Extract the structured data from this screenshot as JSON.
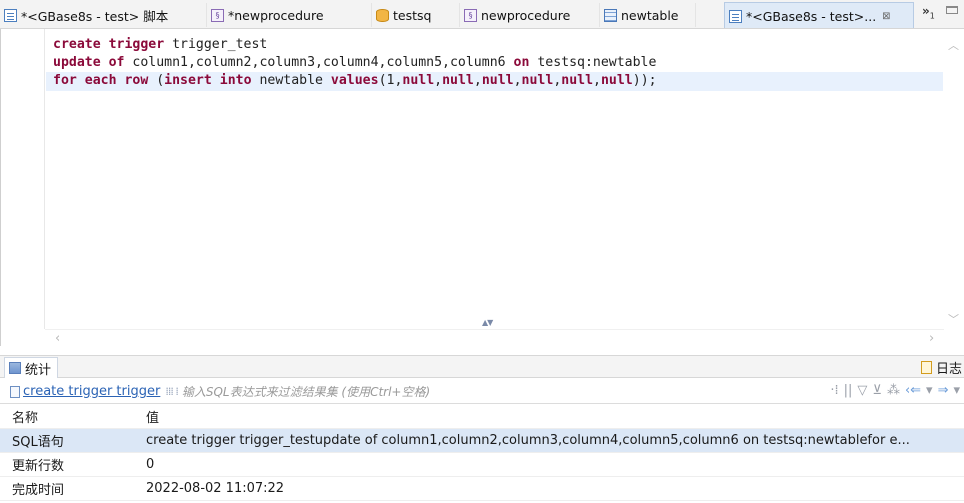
{
  "tabs": [
    {
      "label": "*<GBase8s - test> 脚本",
      "icon": "script-doc-icon"
    },
    {
      "label": "*newprocedure",
      "icon": "procedure-icon"
    },
    {
      "label": "testsq",
      "icon": "database-icon"
    },
    {
      "label": "newprocedure",
      "icon": "procedure-icon"
    },
    {
      "label": "newtable",
      "icon": "table-icon"
    },
    {
      "label": "*<GBase8s - test>...",
      "icon": "script-doc-icon",
      "active": true
    }
  ],
  "tab_overflow": {
    "label": "»",
    "count": "1"
  },
  "editor": {
    "lines": [
      [
        {
          "t": "create trigger",
          "k": true
        },
        {
          "t": " trigger_test",
          "k": false
        }
      ],
      [
        {
          "t": "update of",
          "k": true
        },
        {
          "t": " column1,column2,column3,column4,column5,column6 ",
          "k": false
        },
        {
          "t": "on",
          "k": true
        },
        {
          "t": " testsq:newtable",
          "k": false
        }
      ],
      [
        {
          "t": "for each row",
          "k": true
        },
        {
          "t": " (",
          "k": false
        },
        {
          "t": "insert into",
          "k": true
        },
        {
          "t": " newtable ",
          "k": false
        },
        {
          "t": "values",
          "k": true
        },
        {
          "t": "(1,",
          "k": false
        },
        {
          "t": "null",
          "k": true
        },
        {
          "t": ",",
          "k": false
        },
        {
          "t": "null",
          "k": true
        },
        {
          "t": ",",
          "k": false
        },
        {
          "t": "null",
          "k": true
        },
        {
          "t": ",",
          "k": false
        },
        {
          "t": "null",
          "k": true
        },
        {
          "t": ",",
          "k": false
        },
        {
          "t": "null",
          "k": true
        },
        {
          "t": ",",
          "k": false
        },
        {
          "t": "null",
          "k": true
        },
        {
          "t": "));",
          "k": false
        }
      ]
    ]
  },
  "panel": {
    "tab_label": "统计",
    "log_label": "日志",
    "query_label": "create trigger trigger",
    "filter_placeholder": "输入SQL表达式来过滤结果集 (使用Ctrl+空格)"
  },
  "table": {
    "headers": [
      "名称",
      "值"
    ],
    "rows": [
      {
        "name": "SQL语句",
        "value": "create trigger trigger_testupdate of column1,column2,column3,column4,column5,column6 on testsq:newtablefor e...",
        "selected": true
      },
      {
        "name": "更新行数",
        "value": "0"
      },
      {
        "name": "完成时间",
        "value": "2022-08-02 11:07:22"
      }
    ]
  },
  "colors": {
    "keyword": "#8b0a3a",
    "link": "#2b63b5",
    "selection": "#dbe7f6",
    "current_line": "#e8f1fd"
  }
}
